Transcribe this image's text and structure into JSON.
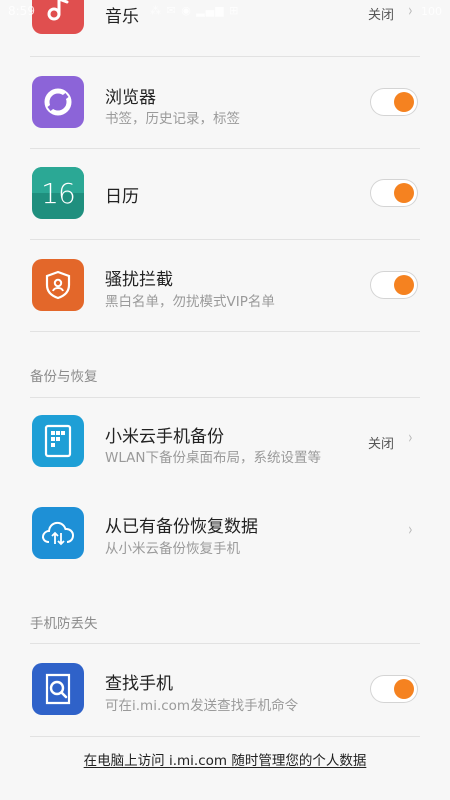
{
  "status_bar": {
    "time": "8:59",
    "icons": "⁂ ✉ ◉ ▂▄▆ ⊞",
    "battery": "100"
  },
  "colors": {
    "accent": "#f58220",
    "music_icon": "#e04f4f",
    "browser_icon": "#8c64d8",
    "calendar_icon": "#1f8f7e",
    "block_icon": "#e3672a",
    "cloud_icon": "#1e90d6",
    "find_icon": "#2f62c9"
  },
  "rows": {
    "music": {
      "icon": "music-note-icon",
      "title": "音乐",
      "status": "关闭"
    },
    "browser": {
      "icon": "browser-icon",
      "title": "浏览器",
      "subtitle": "书签，历史记录，标签",
      "enabled": true
    },
    "calendar": {
      "icon": "calendar-icon",
      "title": "日历",
      "icon_text": "16",
      "enabled": true
    },
    "harass": {
      "icon": "shield-user-icon",
      "title": "骚扰拦截",
      "subtitle": "黑白名单，勿扰模式VIP名单",
      "enabled": true
    }
  },
  "backup_section": {
    "header": "备份与恢复",
    "cloud_backup": {
      "icon": "backup-grid-icon",
      "title": "小米云手机备份",
      "subtitle": "WLAN下备份桌面布局，系统设置等",
      "status": "关闭"
    },
    "restore": {
      "icon": "cloud-restore-icon",
      "title": "从已有备份恢复数据",
      "subtitle": "从小米云备份恢复手机"
    }
  },
  "find_section": {
    "header": "手机防丢失",
    "find_phone": {
      "icon": "search-phone-icon",
      "title": "查找手机",
      "subtitle": "可在i.mi.com发送查找手机命令",
      "enabled": true
    }
  },
  "footer": {
    "link": "在电脑上访问 i.mi.com 随时管理您的个人数据"
  }
}
